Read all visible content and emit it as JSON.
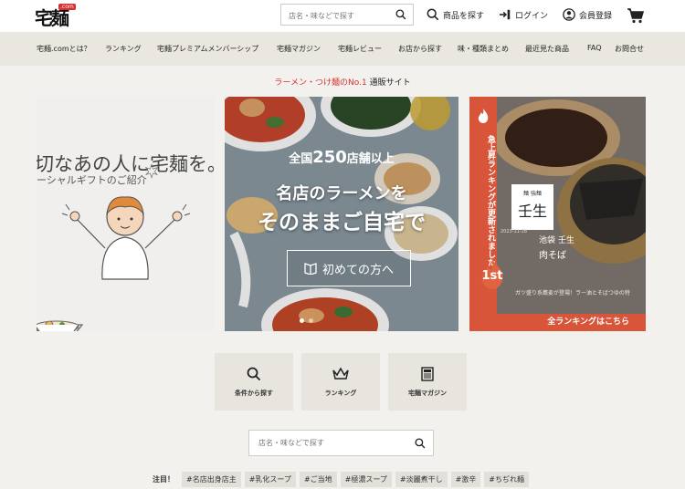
{
  "header": {
    "logo_text": "宅麺",
    "logo_badge": ".com",
    "search_placeholder": "店名・味などで探す",
    "find_product": "商品を探す",
    "login": "ログイン",
    "register": "会員登録"
  },
  "nav": {
    "items": [
      "宅麺.comとは？",
      "ランキング",
      "宅麺プレミアムメンバーシップ",
      "宅麺マガジン",
      "宅麺レビュー",
      "お店から探す",
      "味・種類まとめ",
      "最近見た商品",
      "FAQ",
      "お問合せ"
    ]
  },
  "tagline": {
    "red": "ラーメン・つけ麺のNo.1",
    "rest": " 通販サイト"
  },
  "carousel": {
    "left": {
      "line1": "切なあの人に宅麺を。",
      "line2": "ーシャルギフトのご紹介"
    },
    "center": {
      "line1_pre": "全国",
      "line1_num": "250",
      "line1_post": "店舗以上",
      "line2": "名店のラーメンを",
      "line3": "そのままご自宅で",
      "button": "初めての方へ"
    },
    "right": {
      "vertical": "急上昇ランキングが更新されました",
      "card_small": "麺 強麺",
      "card_big": "壬生",
      "date": "2023-11-28",
      "shop": "池袋 壬生",
      "product": "肉そば",
      "rank": "1st",
      "desc": "ガツ盛り系蕎麦が登場！ラー油とそばつゆの特",
      "all_link": "全ランキングはこちら"
    }
  },
  "quick": {
    "search": "条件から探す",
    "ranking": "ランキング",
    "magazine": "宅麺マガジン"
  },
  "search_mid": {
    "placeholder": "店名・味などで探す"
  },
  "tags": {
    "label": "注目！",
    "items": [
      "#名店出身店主",
      "#乳化スープ",
      "#ご当地",
      "#極濃スープ",
      "#淡麗煮干し",
      "#激辛",
      "#ちぢれ麺"
    ]
  },
  "colors": {
    "accent_red": "#d32f2f",
    "ranking_orange": "#d8553a",
    "nav_bg": "#eae7e1"
  }
}
